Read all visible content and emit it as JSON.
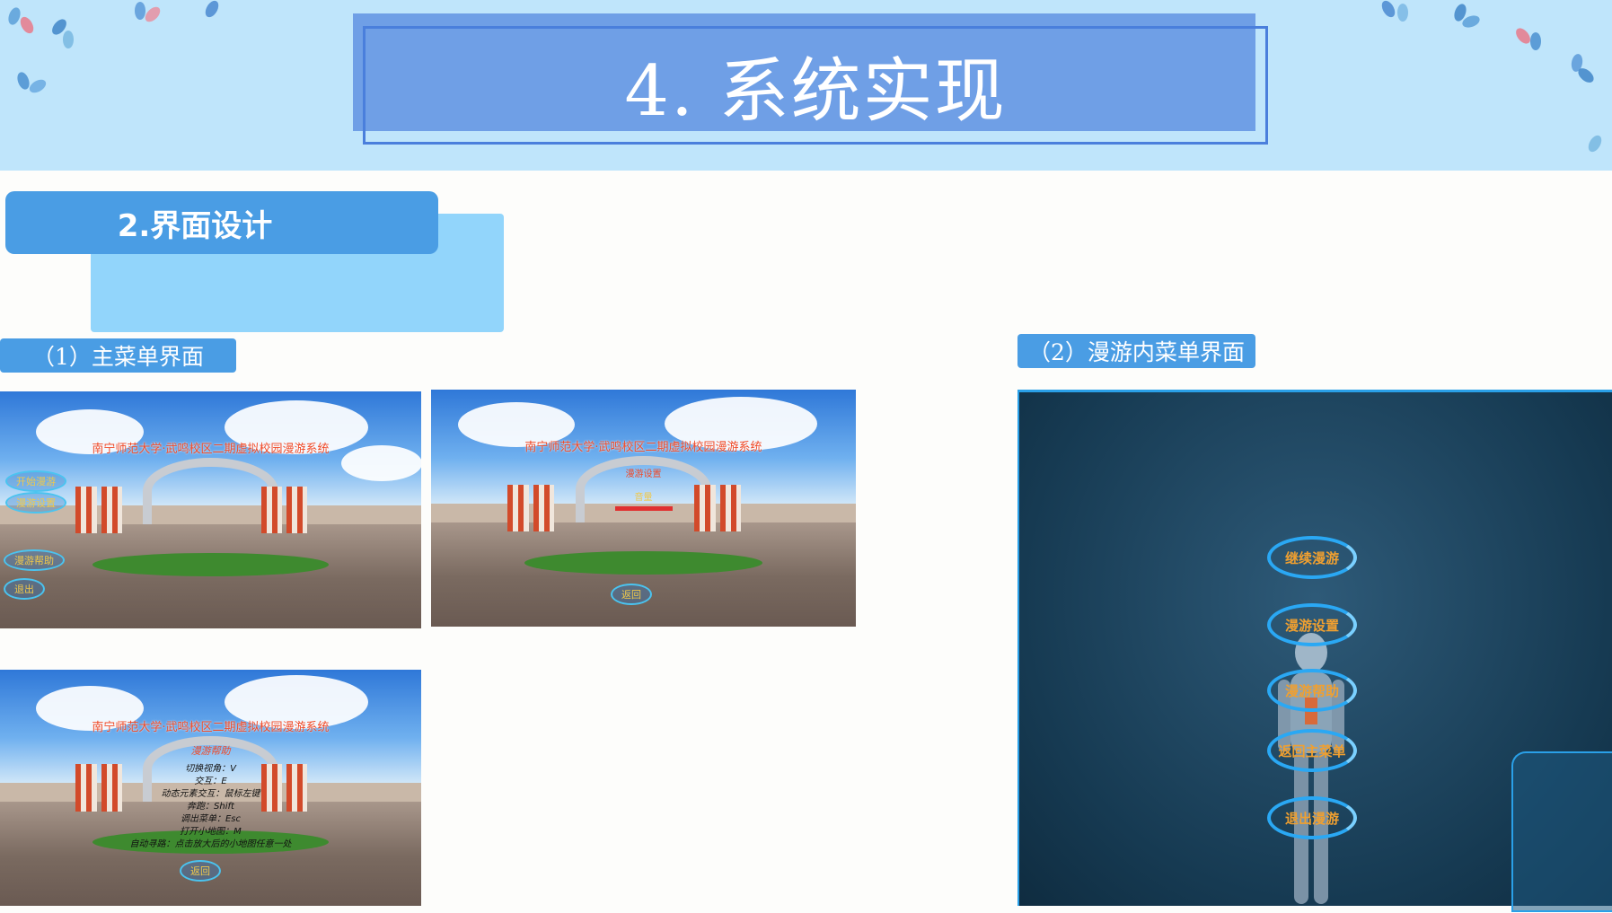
{
  "slide": {
    "title": "4. 系统实现",
    "section": "2.界面设计",
    "caption_main_menu": "（1）主菜单界面",
    "caption_ingame_menu": "（2）漫游内菜单界面"
  },
  "main_menu_shots": {
    "game_title": "南宁师范大学·武鸣校区二期虚拟校园漫游系统",
    "shot1_buttons": [
      "开始漫游",
      "漫游设置",
      "漫游帮助",
      "退出"
    ],
    "shot2_items": [
      "漫游设置",
      "音量",
      "返回"
    ],
    "shot3_heading": "漫游帮助",
    "shot3_help_lines": [
      "切换视角：V",
      "交互：E",
      "动态元素交互：鼠标左键",
      "奔跑：Shift",
      "调出菜单：Esc",
      "打开小地图：M",
      "自动寻路：点击放大后的小地图任意一处"
    ],
    "shot3_button": "返回"
  },
  "ingame_menu": {
    "buttons": [
      "继续漫游",
      "漫游设置",
      "漫游帮助",
      "返回主菜单",
      "退出漫游"
    ]
  },
  "colors": {
    "header_bg": "#bfe5fb",
    "title_box": "#6f9fe6",
    "accent_blue": "#4a9de4",
    "ring_blue": "#2aa8f4",
    "menu_text_orange": "#f0a030"
  }
}
